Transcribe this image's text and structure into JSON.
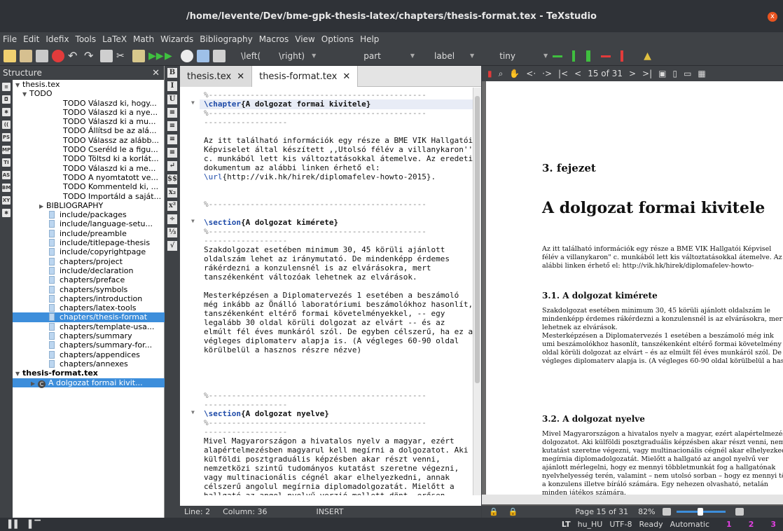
{
  "window": {
    "title": "/home/levente/Dev/bme-gpk-thesis-latex/chapters/thesis-format.tex - TeXstudio",
    "close_label": "x"
  },
  "menu": [
    "File",
    "Edit",
    "Idefix",
    "Tools",
    "LaTeX",
    "Math",
    "Wizards",
    "Bibliography",
    "Macros",
    "View",
    "Options",
    "Help"
  ],
  "toolbar": {
    "left_label": "\\left(",
    "right_label": "\\right)",
    "sectioning": "part",
    "ref": "label",
    "size": "tiny"
  },
  "structure": {
    "title": "Structure",
    "root1": "thesis.tex",
    "todo_group": "TODO",
    "todos": [
      "TODO Válaszd ki, hogy...",
      "TODO Válaszd ki a nye...",
      "TODO Válaszd ki a mu...",
      "TODO Állítsd be az alá...",
      "TODO Válassz az alább...",
      "TODO Cseréld le a figu...",
      "TODO Töltsd ki a korlát...",
      "TODO Válaszd ki a me...",
      "TODO A nyomtatott ve...",
      "TODO Kommenteld ki, ...",
      "TODO Importáld a saját..."
    ],
    "bib_group": "BIBLIOGRAPHY",
    "files": [
      "include/packages",
      "include/language-setu...",
      "include/preamble",
      "include/titlepage-thesis",
      "include/copyrightpage",
      "chapters/project",
      "include/declaration",
      "chapters/preface",
      "chapters/symbols",
      "chapters/introduction",
      "chapters/latex-tools",
      "chapters/thesis-format",
      "chapters/template-usa...",
      "chapters/summary",
      "chapters/summary-for...",
      "chapters/appendices",
      "chapters/annexes"
    ],
    "root2": "thesis-format.tex",
    "chapter_node": "A dolgozat formai kivit...",
    "side_icons": [
      "≡",
      "◘",
      "✱",
      "((",
      "PS",
      "MP",
      "TI",
      "AS",
      "BM",
      "XY",
      "✱"
    ]
  },
  "mid_tools": [
    "B",
    "I",
    "U",
    "≡",
    "≡",
    "≡",
    "≡",
    "↵",
    "$$",
    "x₂",
    "x²",
    "÷",
    "⅓",
    "√"
  ],
  "tabs": [
    {
      "label": "thesis.tex"
    },
    {
      "label": "thesis-format.tex"
    }
  ],
  "editor": {
    "lines": [
      {
        "t": "%-----------------------------------------------",
        "c": "dash"
      },
      {
        "t": "\\chapter{A dolgozat formai kivitele}",
        "c": "head",
        "cmd": "\\chapter",
        "arg": "{A dolgozat formai kivitele}"
      },
      {
        "t": "%-----------------------------------------------",
        "c": "dash"
      },
      {
        "t": "------------------",
        "c": "dash"
      },
      {
        "t": "",
        "c": ""
      },
      {
        "t": "Az itt található információk egy része a BME VIK Hallgatói",
        "c": ""
      },
      {
        "t": "Képviselet által készített ,,Utolsó félév a villanykaron''",
        "c": ""
      },
      {
        "t": "c. munkából lett kis változtatásokkal átemelve. Az eredeti",
        "c": ""
      },
      {
        "t": "dokumentum az alábbi linken érhető el:",
        "c": ""
      },
      {
        "t": "\\url{http://vik.hk/hirek/diplomafelev-howto-2015}.",
        "c": "url",
        "cmd": "\\url",
        "arg": "{http://vik.hk/hirek/diplomafelev-howto-2015}."
      },
      {
        "t": "",
        "c": ""
      },
      {
        "t": "",
        "c": ""
      },
      {
        "t": "%-----------------------------------------------",
        "c": "dash"
      },
      {
        "t": "",
        "c": ""
      },
      {
        "t": "\\section{A dolgozat kimérete}",
        "c": "head",
        "cmd": "\\section",
        "arg": "{A dolgozat kimérete}"
      },
      {
        "t": "%-----------------------------------------------",
        "c": "dash"
      },
      {
        "t": "------------------",
        "c": "dash"
      },
      {
        "t": "Szakdolgozat esetében minimum 30, 45 körüli ajánlott",
        "c": ""
      },
      {
        "t": "oldalszám lehet az iránymutató. De mindenképp érdemes",
        "c": ""
      },
      {
        "t": "rákérdezni a konzulensnél is az elvárásokra, mert",
        "c": ""
      },
      {
        "t": "tanszékenként változóak lehetnek az elvárások.",
        "c": ""
      },
      {
        "t": "",
        "c": ""
      },
      {
        "t": "Mesterképzésen a Diplomatervezés 1 esetében a beszámoló",
        "c": ""
      },
      {
        "t": "még inkább az Önálló laboratóriumi beszámolókhoz hasonlít,",
        "c": ""
      },
      {
        "t": "tanszékenként eltérő formai követelményekkel, -- egy",
        "c": ""
      },
      {
        "t": "legalább 30 oldal körüli dolgozat az elvárt -- és az",
        "c": ""
      },
      {
        "t": "elmúlt fél éves munkáról szól. De egyben célszerű, ha ez a",
        "c": ""
      },
      {
        "t": "végleges diplomaterv alapja is. (A végleges 60-90 oldal",
        "c": ""
      },
      {
        "t": "körülbelül a hasznos részre nézve)",
        "c": ""
      },
      {
        "t": "",
        "c": ""
      },
      {
        "t": "",
        "c": ""
      },
      {
        "t": "",
        "c": ""
      },
      {
        "t": "",
        "c": ""
      },
      {
        "t": "%-----------------------------------------------",
        "c": "dash"
      },
      {
        "t": "------------------",
        "c": "dash"
      },
      {
        "t": "\\section{A dolgozat nyelve}",
        "c": "head",
        "cmd": "\\section",
        "arg": "{A dolgozat nyelve}"
      },
      {
        "t": "%-----------------------------------------------",
        "c": "dash"
      },
      {
        "t": "------------------",
        "c": "dash"
      },
      {
        "t": "Mivel Magyarországon a hivatalos nyelv a magyar, ezért",
        "c": ""
      },
      {
        "t": "alapértelmezésben magyarul kell megírni a dolgozatot. Aki",
        "c": ""
      },
      {
        "t": "külföldi posztgraduális képzésben akar részt venni,",
        "c": ""
      },
      {
        "t": "nemzetközi szintű tudományos kutatást szeretne végezni,",
        "c": ""
      },
      {
        "t": "vagy multinacionális cégnél akar elhelyezkedni, annak",
        "c": ""
      },
      {
        "t": "célszerű angolul megírnia diplomadolgozatát. Mielőtt a",
        "c": ""
      },
      {
        "t": "hallgató az angol nyelvű verzió mellett dönt, erősen",
        "c": ""
      },
      {
        "t": "ajánlott mérlegelni, hogy ez mennyi többletmunkát fog a",
        "c": ""
      }
    ],
    "status_line": "Line: 2",
    "status_col": "Column: 36",
    "status_mode": "INSERT"
  },
  "pdf": {
    "page_label": "15 of 31",
    "chapter_num": "3. fejezet",
    "chapter_title": "A dolgozat formai kivitele",
    "p1": [
      "Az itt található információk egy része a BME VIK Hallgatói Képvisel",
      "félév a villanykaron\" c. munkából lett kis változtatásokkal átemelve. Az",
      "alábbi linken érhető el: http://vik.hk/hirek/diplomafelev-howto-"
    ],
    "s1": "3.1. A dolgozat kimérete",
    "p2": [
      "Szakdolgozat esetében minimum 30, 45 körüli ajánlott oldalszám le",
      "mindenképp érdemes rákérdezni a konzulensnél is az elvárásokra, mert",
      "lehetnek az elvárások.",
      "    Mesterképzésen a Diplomatervezés 1 esetében a beszámoló még ink",
      "umi beszámolókhoz hasonlít, tanszékenként eltérő formai követelmény",
      "oldal körüli dolgozat az elvárt – és az elmúlt fél éves munkáról szól. De",
      "végleges diplomaterv alapja is. (A végleges 60-90 oldal körülbelül a has"
    ],
    "s2": "3.2. A dolgozat nyelve",
    "p3": [
      "Mivel Magyarországon a hivatalos nyelv a magyar, ezért alapértelmezésbe",
      "dolgozatot. Aki külföldi posztgraduális képzésben akar részt venni, nemz",
      "kutatást szeretne végezni, vagy multinacionális cégnél akar elhelyezkedn",
      "megírnia diplomadolgozatát. Mielőtt a hallgató az angol nyelvű ver",
      "ajánlott mérlegelni, hogy ez mennyi többletmunkát fog a hallgatónak",
      "nyelvhelyesség terén, valamint – nem utolsó sorban – hogy ez mennyi töb",
      "a konzulens illetve bíráló számára. Egy nehezen olvasható, netalán",
      "minden játékos számára."
    ],
    "status_page": "Page 15 of 31",
    "zoom": "82%"
  },
  "statusbar": {
    "lang": "hu_HU",
    "encoding": "UTF-8",
    "ready": "Ready",
    "mode": "Automatic",
    "bm1": "1",
    "bm2": "2",
    "bm3": "3"
  },
  "colors": {
    "accent": "#3d8edb",
    "cmd": "#1e4aa8",
    "close": "#e95420"
  }
}
